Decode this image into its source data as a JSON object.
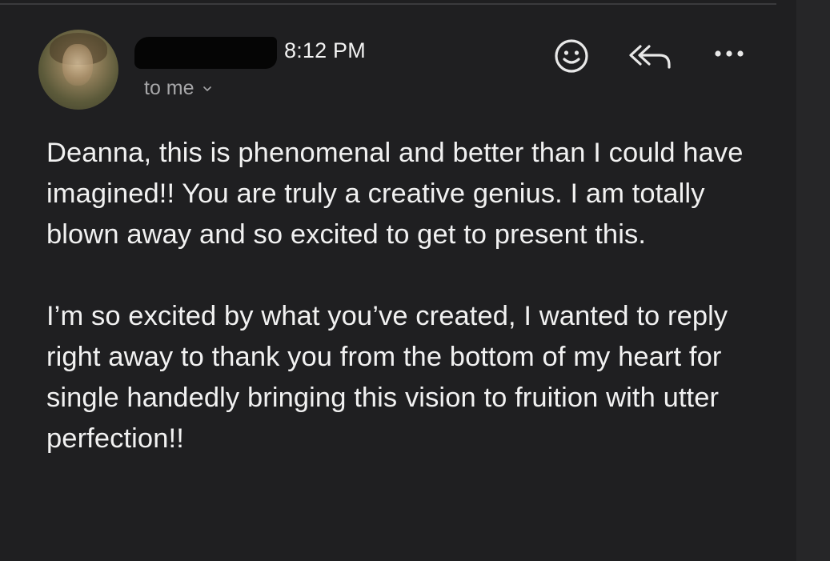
{
  "header": {
    "time": "8:12 PM",
    "recipient": "to me"
  },
  "icons": {
    "avatar": "sender-avatar",
    "redaction": "sender-name-redacted",
    "recipient_chevron": "chevron-down-icon",
    "emoji": "emoji-icon",
    "reply_all": "reply-all-icon",
    "more": "more-options-icon"
  },
  "message": {
    "paragraphs": [
      "Deanna, this is phenomenal and better than I could have imagined!! You are truly a creative genius. I am totally blown away and so excited to get to present this.",
      "I’m so excited by what you’ve created, I wanted to reply right away to thank you from the bottom of my heart for single handedly bringing this vision to fruition with utter perfection!!"
    ]
  },
  "colors": {
    "background": "#1f1f21",
    "text": "#f1f1f1",
    "secondary_text": "#a6a6a8"
  }
}
